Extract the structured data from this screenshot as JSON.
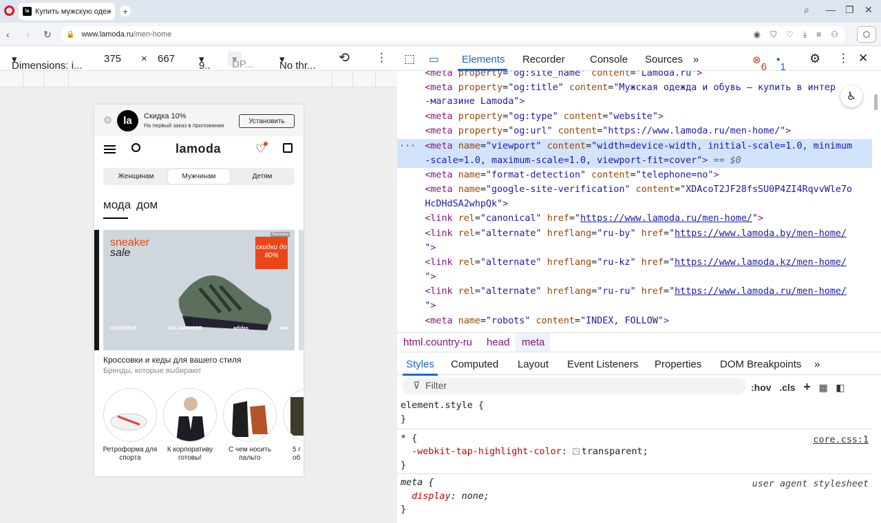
{
  "browser": {
    "tab_title": "Купить мужскую одежду",
    "favicon_text": "la",
    "url_host": "www.lamoda.ru",
    "url_path": "/men-home"
  },
  "device_toolbar": {
    "dimensions": "Dimensions: i...",
    "width": "375",
    "times": "×",
    "height": "667",
    "zoom": "9..",
    "dpr": "DP...",
    "throttle": "No thr..."
  },
  "page": {
    "promo_title": "Скидка 10%",
    "promo_sub": "На первый заказ в приложении",
    "promo_button": "Установить",
    "logo_text": "la",
    "wordmark": "lamoda",
    "gender_tabs": [
      "Женщинам",
      "Мужчинам",
      "Детям"
    ],
    "categories": [
      "мода",
      "дом"
    ],
    "banner": {
      "line1": "sneaker",
      "line2": "sale",
      "badge": "скидки до 80%",
      "ad": "Реклама",
      "brands": [
        "CONVERSE",
        "SALAMANDER",
        "adidas",
        "nike"
      ]
    },
    "banner_title": "Кроссовки и кеды для вашего стиля",
    "banner_sub": "Бренды, которые выбирают",
    "circles": [
      {
        "label": "Ретроформа для спорта"
      },
      {
        "label": "К корпоративу готовы!"
      },
      {
        "label": "С чем носить пальто"
      },
      {
        "label": "5 г об"
      }
    ]
  },
  "devtools": {
    "tabs": [
      "Elements",
      "Recorder",
      "Console",
      "Sources"
    ],
    "errors": "6",
    "messages": "1",
    "breadcrumbs": [
      "html.country-ru",
      "head",
      "meta"
    ],
    "style_tabs": [
      "Styles",
      "Computed",
      "Layout",
      "Event Listeners",
      "Properties",
      "DOM Breakpoints"
    ],
    "filter_placeholder": "Filter",
    "hov": ":hov",
    "cls": ".cls",
    "eq0": "== $0"
  },
  "colors": {
    "brand_accent": "#e9461a",
    "devtools_blue": "#1a66d2"
  }
}
